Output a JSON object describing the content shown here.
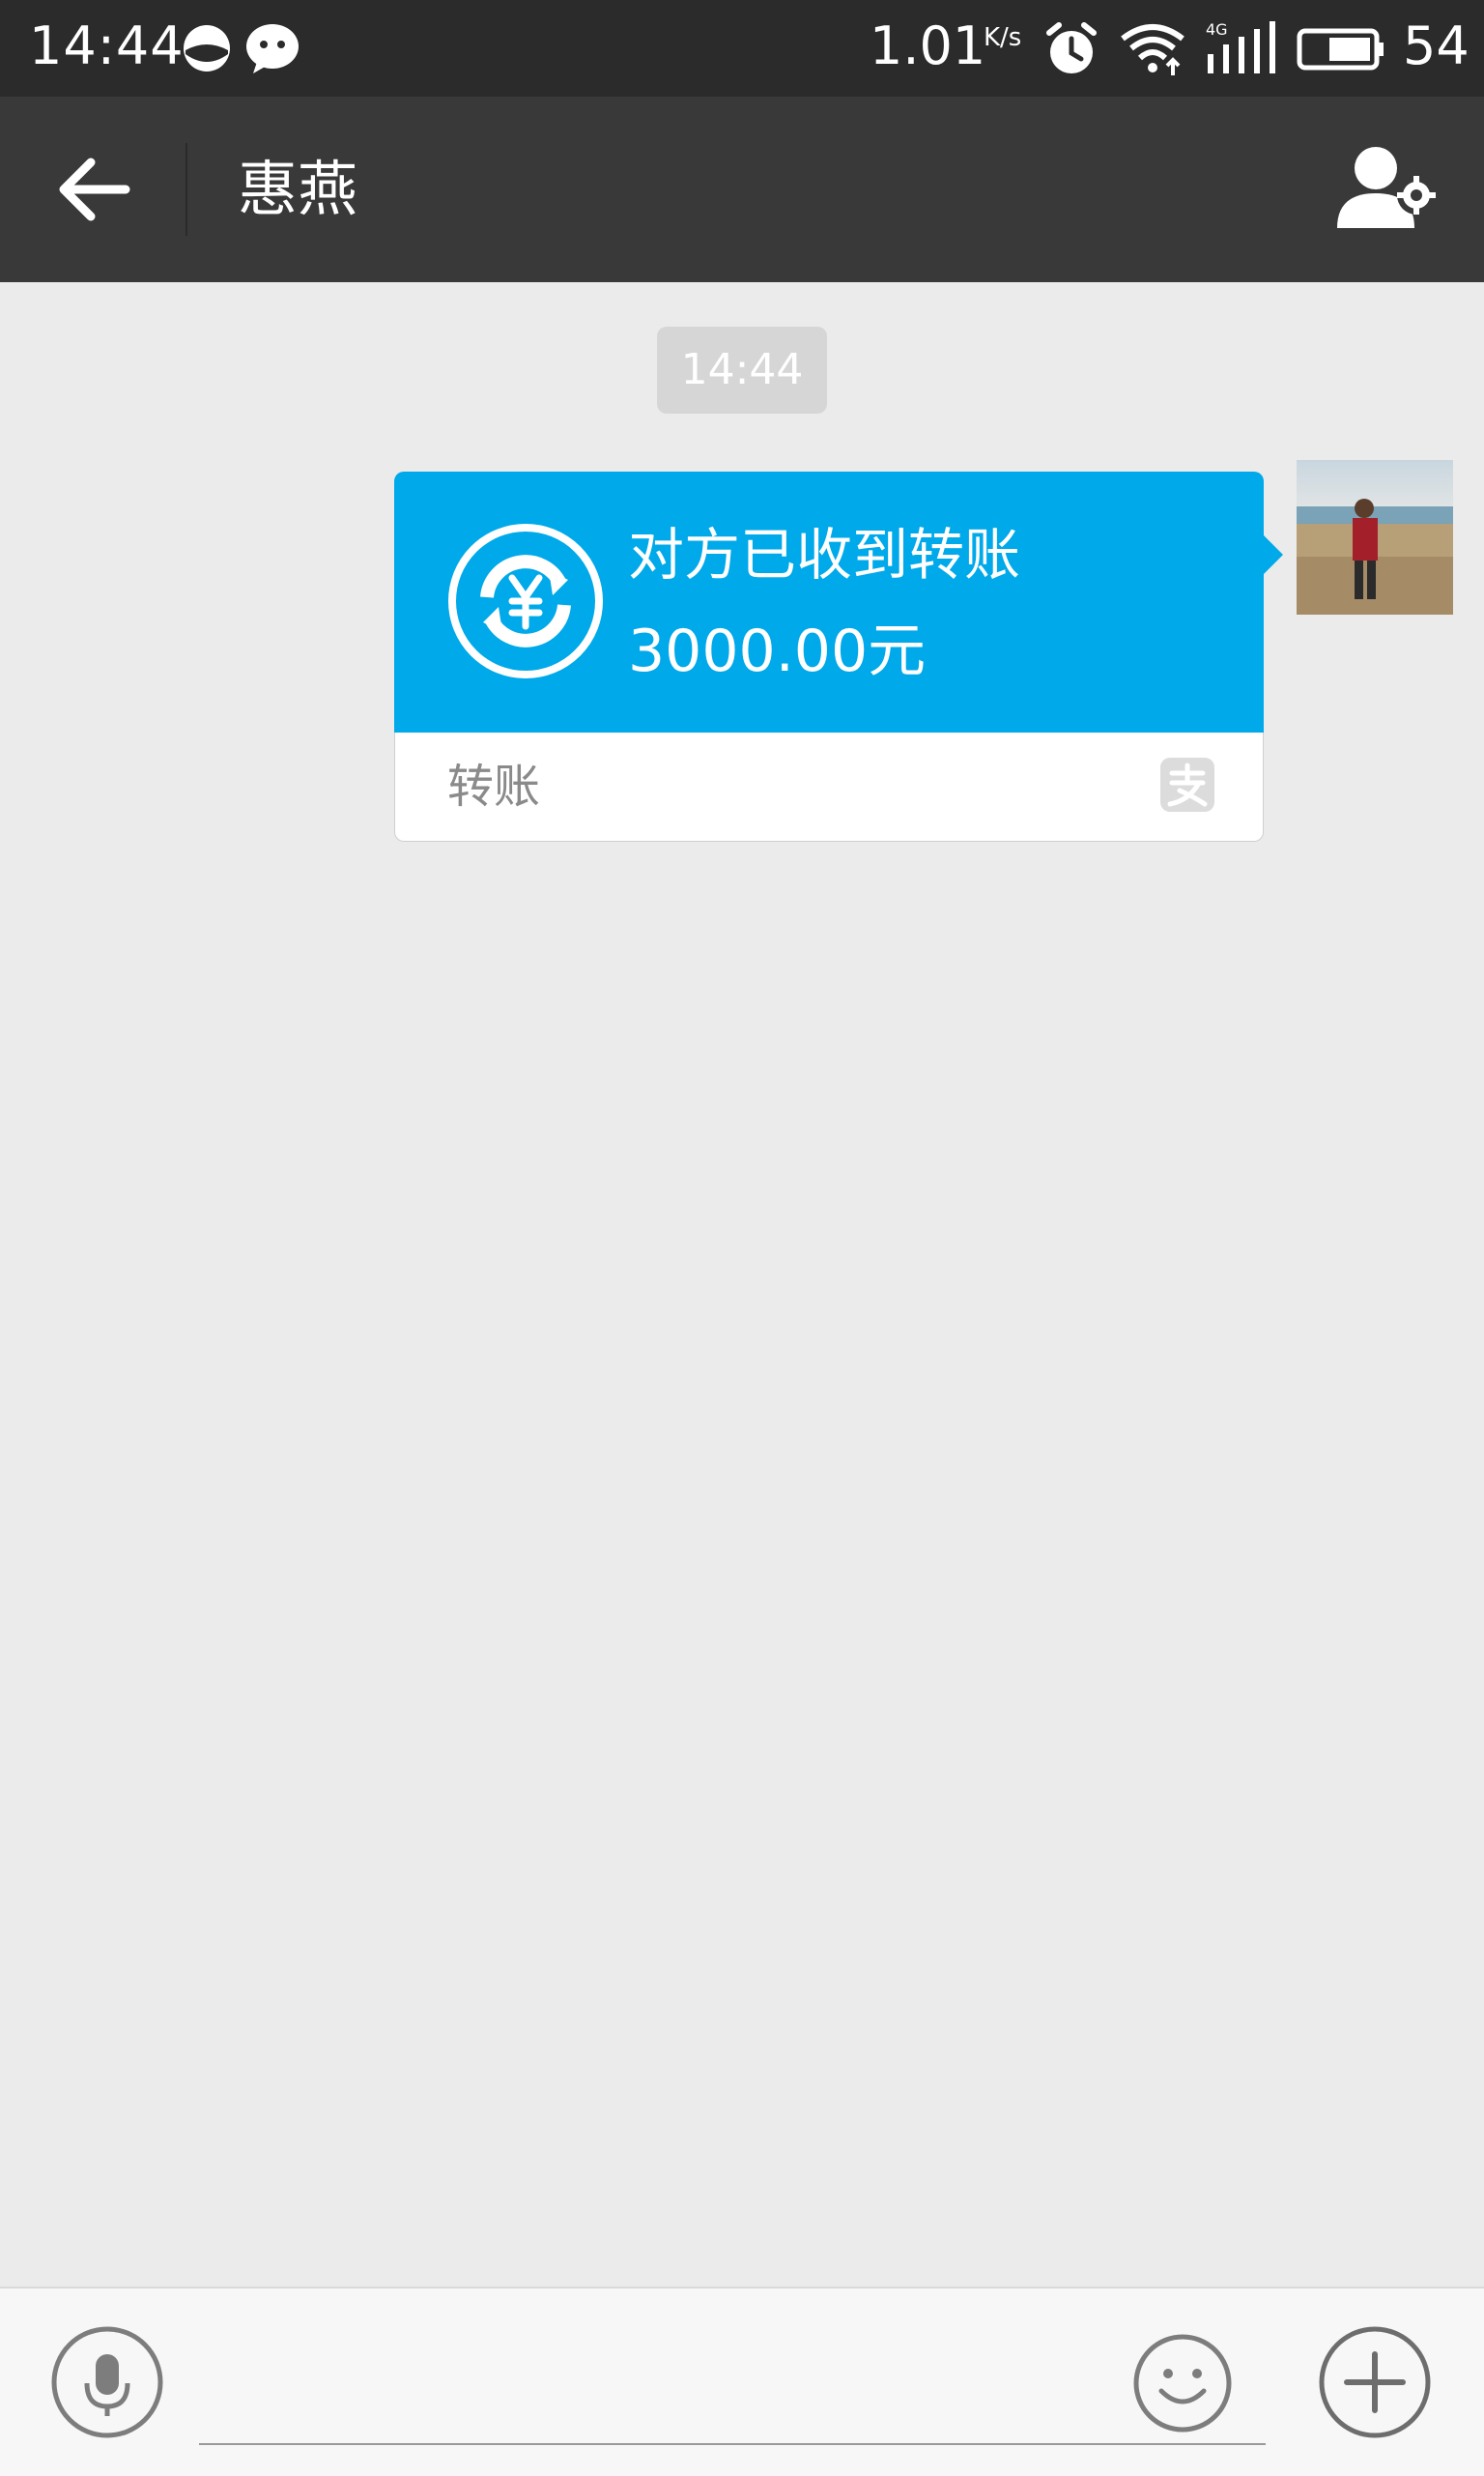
{
  "status_bar": {
    "time": "14:44",
    "net_speed": "1.01",
    "net_speed_unit": "K/s",
    "network_type": "4G",
    "battery": "54",
    "icons": [
      "qq-icon",
      "wechat-icon",
      "alarm-icon",
      "wifi-icon",
      "signal-icon",
      "battery-icon"
    ]
  },
  "header": {
    "back_icon": "arrow-left-icon",
    "title": "惠燕",
    "profile_icon": "user-settings-icon"
  },
  "chat": {
    "timestamp": "14:44",
    "message": {
      "status": "对方已收到转账",
      "amount": "3000.00元",
      "type": "转账",
      "icon": "transfer-yuan-icon",
      "brand_icon": "alipay-icon"
    },
    "avatar_desc": "avatar"
  },
  "input_bar": {
    "voice_icon": "microphone-icon",
    "input_value": "",
    "emoji_icon": "smiley-icon",
    "more_icon": "plus-icon"
  },
  "colors": {
    "status_bar_bg": "#2b2b2b",
    "title_bar_bg": "#393939",
    "chat_bg": "#ebebeb",
    "transfer_blue": "#00a9e9"
  }
}
